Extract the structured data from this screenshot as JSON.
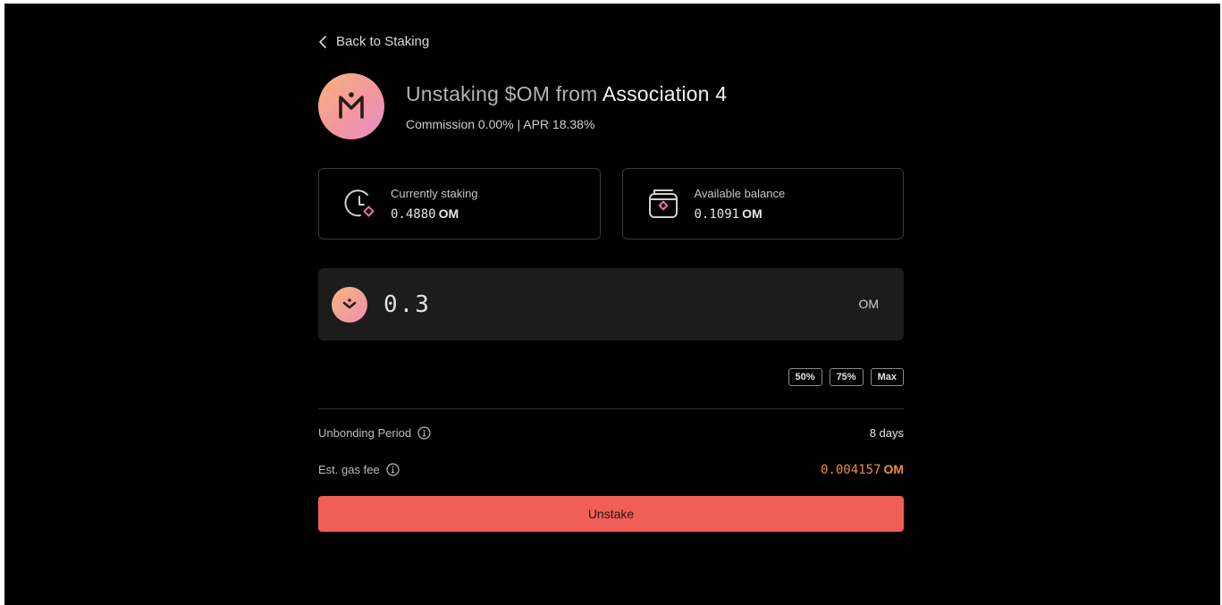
{
  "nav": {
    "back_label": "Back to Staking",
    "back_icon": "chevron-left-icon"
  },
  "header": {
    "title_prefix": "Unstaking $OM from ",
    "validator": "Association 4",
    "subtitle": "Commission 0.00% | APR 18.38%",
    "logo_icon": "mantra-logo-icon"
  },
  "stats": {
    "currently_staking": {
      "label": "Currently staking",
      "amount": "0.4880",
      "unit": "OM",
      "icon": "clock-stake-icon"
    },
    "available_balance": {
      "label": "Available balance",
      "amount": "0.1091",
      "unit": "OM",
      "icon": "wallet-icon"
    }
  },
  "amount_input": {
    "value": "0.3",
    "unit": "OM",
    "icon": "om-token-icon"
  },
  "percent_buttons": {
    "p50": "50%",
    "p75": "75%",
    "max": "Max"
  },
  "details": {
    "unbonding_label": "Unbonding Period",
    "unbonding_value": "8 days",
    "gas_label": "Est. gas fee",
    "gas_amount": "0.004157",
    "gas_unit": "OM",
    "info_icon": "info-icon"
  },
  "action": {
    "unstake_label": "Unstake"
  },
  "colors": {
    "background": "#000000",
    "surface": "#1c1c1c",
    "accent_button": "#ef5f57",
    "gas_fee": "#e8913a",
    "logo_gradient_start": "#f7b57a",
    "logo_gradient_end": "#e88cc9"
  }
}
